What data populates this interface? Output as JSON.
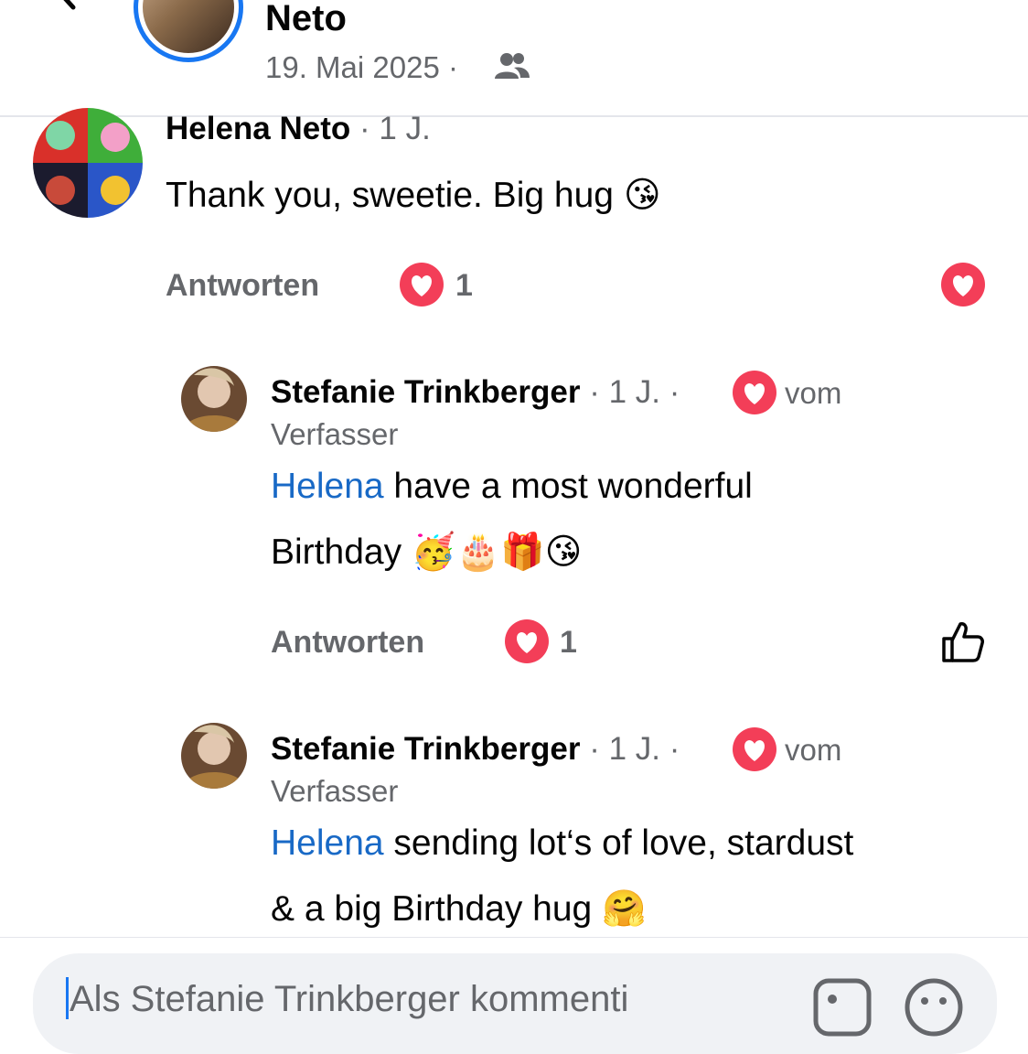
{
  "header": {
    "name": "Neto",
    "date": "19. Mai 2025",
    "separator": "·"
  },
  "comments": [
    {
      "author": "Helena Neto",
      "time": "· 1 J.",
      "text": "Thank you, sweetie. Big hug",
      "emoji": "😘",
      "reply_label": "Antworten",
      "reaction_count": "1"
    },
    {
      "author": "Stefanie Trinkberger",
      "time": "· 1 J. ·",
      "badge_prefix": "vom",
      "badge_suffix": "Verfasser",
      "mention": "Helena",
      "text_line1": " have a most wonderful",
      "text_line2": "Birthday",
      "emoji": "🥳🎂🎁😘",
      "reply_label": "Antworten",
      "reaction_count": "1"
    },
    {
      "author": "Stefanie Trinkberger",
      "time": "· 1 J. ·",
      "badge_prefix": "vom",
      "badge_suffix": "Verfasser",
      "mention": "Helena",
      "text_line1": " sending lot‘s of love, stardust",
      "text_line2": "& a big Birthday hug",
      "emoji": "🤗"
    }
  ],
  "composer": {
    "placeholder": "Als Stefanie Trinkberger kommenti"
  },
  "icons": [
    "back-arrow-icon",
    "more-icon",
    "audience-friends-icon",
    "heart-reaction-icon",
    "like-thumb-icon",
    "sticker-icon",
    "emoji-icon"
  ],
  "colors": {
    "accent": "#1877f2",
    "mention": "#1869c6",
    "heart": "#f33e58",
    "secondary_text": "#65676b"
  }
}
